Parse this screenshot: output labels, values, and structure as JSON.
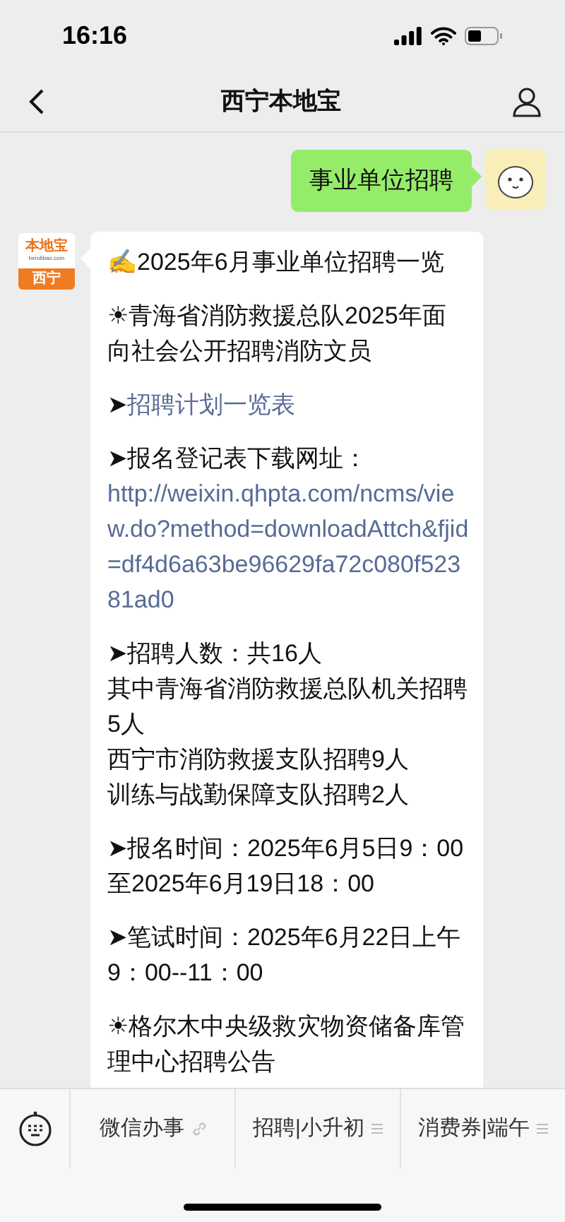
{
  "status_bar": {
    "time": "16:16"
  },
  "header": {
    "title": "西宁本地宝"
  },
  "messages": [
    {
      "kind": "sent",
      "text": "事业单位招聘"
    },
    {
      "kind": "received",
      "logo_text": "本地宝",
      "logo_site": "bendibao.com",
      "logo_city": "西宁",
      "paragraphs": [
        [
          [
            {
              "text": "✍2025年6月事业单位招聘一览",
              "link": false
            }
          ]
        ],
        [
          [
            {
              "text": "☀青海省消防救援总队2025年面向社会公开招聘消防文员",
              "link": false
            }
          ]
        ],
        [
          [
            {
              "text": "➤",
              "link": false
            },
            {
              "text": "招聘计划一览表",
              "link": true
            }
          ]
        ],
        [
          [
            {
              "text": "➤报名登记表下载网址：",
              "link": false
            },
            {
              "text": "http://weixin.qhpta.com/ncms/view.do?method=downloadAttch&fjid=df4d6a63be96629fa72c080f52381ad0",
              "link": true
            }
          ]
        ],
        [
          [
            {
              "text": "➤招聘人数：共16人",
              "link": false
            }
          ],
          [
            {
              "text": "其中青海省消防救援总队机关招聘5人",
              "link": false
            }
          ],
          [
            {
              "text": "西宁市消防救援支队招聘9人",
              "link": false
            }
          ],
          [
            {
              "text": "训练与战勤保障支队招聘2人",
              "link": false
            }
          ]
        ],
        [
          [
            {
              "text": "➤报名时间：2025年6月5日9：00至2025年6月19日18：00",
              "link": false
            }
          ]
        ],
        [
          [
            {
              "text": "➤笔试时间：2025年6月22日上午9：00--11：00",
              "link": false
            }
          ]
        ],
        [
          [
            {
              "text": "☀格尔木中央级救灾物资储备库管理中心招聘公告",
              "link": false
            }
          ]
        ]
      ]
    }
  ],
  "menu": [
    {
      "label": "微信办事",
      "kind": "link"
    },
    {
      "label": "招聘|小升初",
      "kind": "submenu"
    },
    {
      "label": "消费券|端午",
      "kind": "submenu"
    }
  ]
}
